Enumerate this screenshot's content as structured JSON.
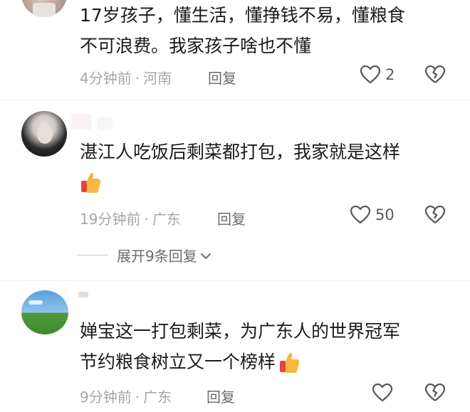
{
  "comments": [
    {
      "text_lines": [
        "17岁孩子，懂生活，懂挣钱不易，懂粮食",
        "不可浪费。我家孩子啥也不懂"
      ],
      "time": "4分钟前",
      "location": "河南",
      "reply_label": "回复",
      "likes": "2"
    },
    {
      "text_lines": [
        "湛江人吃饭后剩菜都打包，我家就是这样"
      ],
      "time": "19分钟前",
      "location": "广东",
      "reply_label": "回复",
      "likes": "50",
      "expand_label": "展开9条回复"
    },
    {
      "text_lines": [
        "婵宝这一打包剩菜，为广东人的世界冠军",
        "节约粮食树立又一个榜样"
      ],
      "time": "9分钟前",
      "location": "广东",
      "reply_label": "回复",
      "likes": ""
    }
  ],
  "icons": {
    "like": "heart-outline-icon",
    "dislike": "broken-heart-icon",
    "thumb": "thumbs-up-emoji",
    "expand": "chevron-down-icon"
  },
  "colors": {
    "text": "#1a1a1a",
    "meta": "#a6a6a6",
    "icon": "#5a5a5a"
  }
}
